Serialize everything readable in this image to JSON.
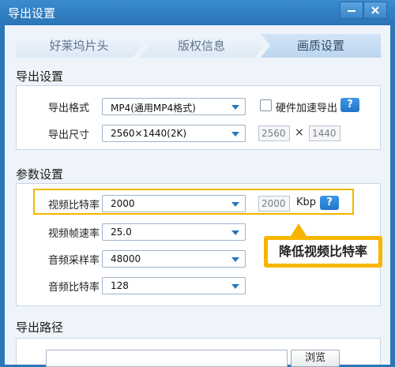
{
  "window": {
    "title": "导出设置"
  },
  "steps": [
    "好莱坞片头",
    "版权信息",
    "画质设置"
  ],
  "export_settings": {
    "title": "导出设置",
    "format_label": "导出格式",
    "format_value": "MP4(通用MP4格式)",
    "hw_accel_label": "硬件加速导出",
    "size_label": "导出尺寸",
    "size_value": "2560×1440(2K)",
    "width": "2560",
    "height": "1440",
    "times": "×"
  },
  "params": {
    "title": "参数设置",
    "video_bitrate_label": "视频比特率",
    "video_bitrate_value": "2000",
    "video_bitrate_display": "2000",
    "video_bitrate_unit": "Kbp",
    "framerate_label": "视频帧速率",
    "framerate_value": "25.0",
    "audio_samplerate_label": "音频采样率",
    "audio_samplerate_value": "48000",
    "audio_bitrate_label": "音频比特率",
    "audio_bitrate_value": "128"
  },
  "callout": {
    "text": "降低视频比特率"
  },
  "export_path": {
    "title": "导出路径",
    "browse_label": "浏览"
  },
  "help_label": "?",
  "colors": {
    "accent": "#2b78b8",
    "highlight": "#f4b400",
    "help": "#2275c9"
  }
}
